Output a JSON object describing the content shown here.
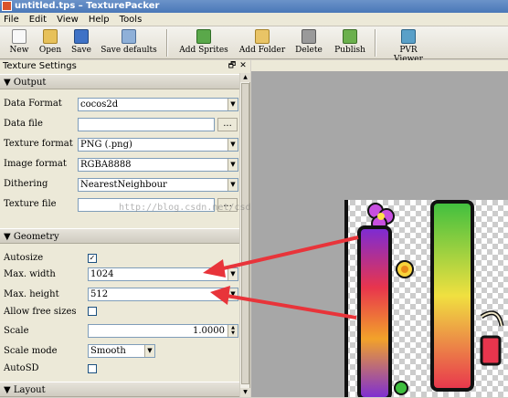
{
  "window": {
    "title": "untitled.tps – TexturePacker"
  },
  "menu": [
    "File",
    "Edit",
    "View",
    "Help",
    "Tools"
  ],
  "toolbar": {
    "buttons": [
      {
        "label": "New",
        "icon": "new-file-icon",
        "color": "#f4f4f4"
      },
      {
        "label": "Open",
        "icon": "open-folder-icon",
        "color": "#e7c15a"
      },
      {
        "label": "Save",
        "icon": "save-disk-icon",
        "color": "#3f72c6"
      },
      {
        "label": "Save defaults",
        "icon": "save-defaults-icon",
        "color": "#8fb0d8"
      },
      {
        "label": "Add Sprites",
        "icon": "add-sprites-icon",
        "color": "#5aa84a"
      },
      {
        "label": "Add Folder",
        "icon": "add-folder-icon",
        "color": "#e9c466"
      },
      {
        "label": "Delete",
        "icon": "trash-icon",
        "color": "#9a9a9a"
      },
      {
        "label": "Publish",
        "icon": "publish-icon",
        "color": "#6bb04d"
      },
      {
        "label": "PVR Viewer",
        "icon": "pvr-viewer-icon",
        "color": "#5aa0c8"
      }
    ]
  },
  "panel": {
    "title": "Texture Settings",
    "controls": {
      "float": "🗗",
      "close": "✕"
    },
    "output": {
      "header": "Output",
      "data_format_label": "Data Format",
      "data_format": "cocos2d",
      "data_file_label": "Data file",
      "data_file": "",
      "texture_format_label": "Texture format",
      "texture_format": "PNG (.png)",
      "image_format_label": "Image format",
      "image_format": "RGBA8888",
      "dithering_label": "Dithering",
      "dithering": "NearestNeighbour",
      "texture_file_label": "Texture file",
      "texture_file": "",
      "browse": "..."
    },
    "geometry": {
      "header": "Geometry",
      "autosize_label": "Autosize",
      "autosize": true,
      "max_width_label": "Max. width",
      "max_width": "1024",
      "max_height_label": "Max. height",
      "max_height": "512",
      "allow_free_sizes_label": "Allow free sizes",
      "allow_free_sizes": false,
      "scale_label": "Scale",
      "scale": "1.0000",
      "scale_mode_label": "Scale mode",
      "scale_mode": "Smooth",
      "autosd_label": "AutoSD",
      "autosd": false
    },
    "layout": {
      "header": "Layout"
    }
  },
  "watermark": "http://blog.csdn.net/csd",
  "colors": {
    "arrow": "#e8343a",
    "title_bar": "#5a86c2"
  }
}
